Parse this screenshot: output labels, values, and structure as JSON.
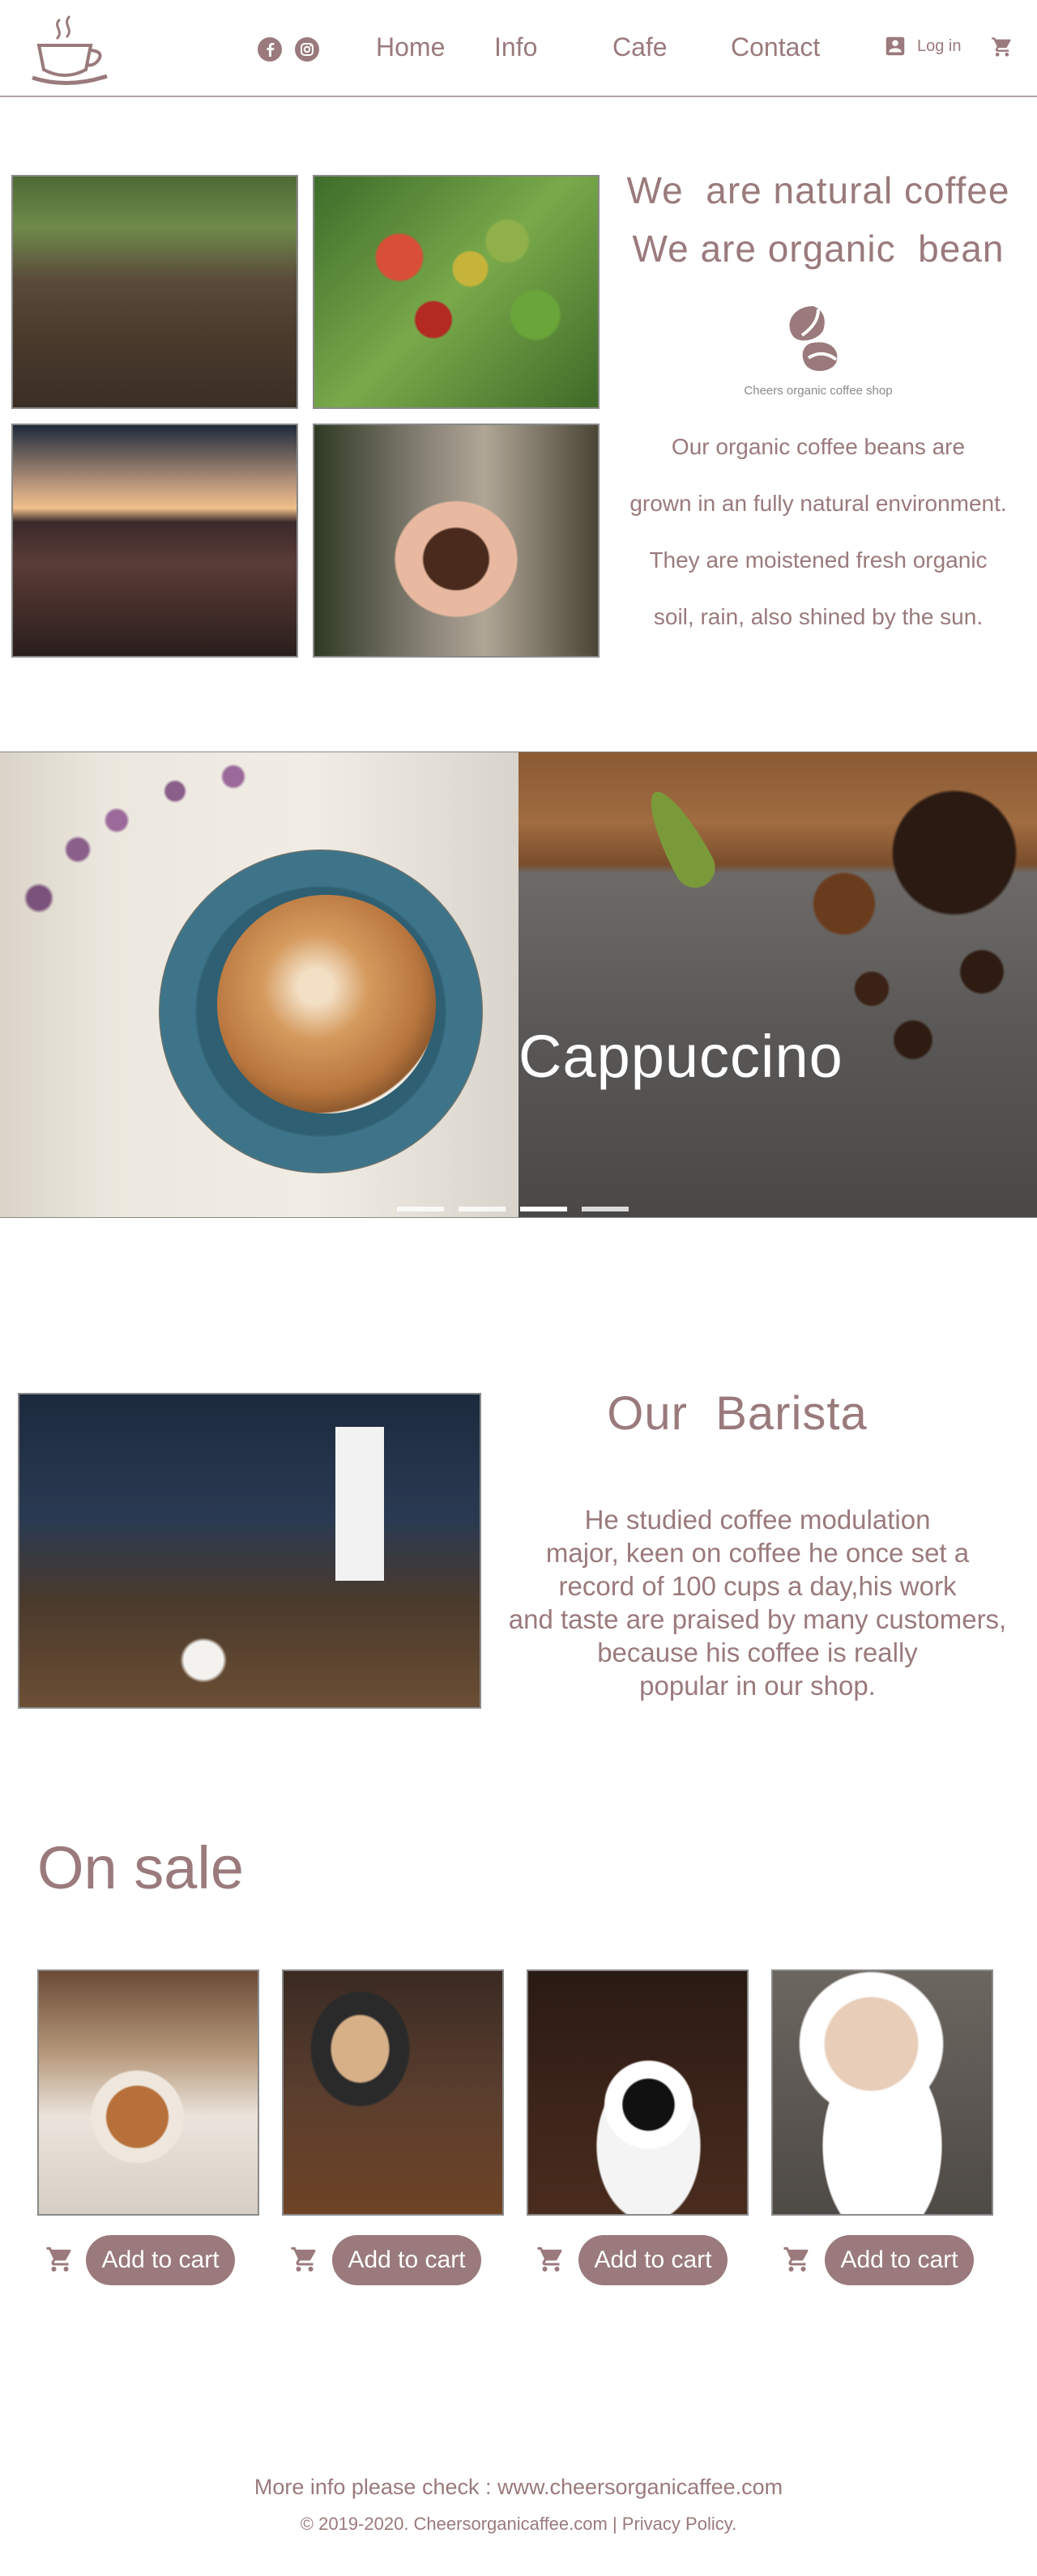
{
  "colors": {
    "accent": "#9a7a7c",
    "background": "#ffffff",
    "divider": "#b5a3a4"
  },
  "header": {
    "logo_icon": "coffee-cup-logo",
    "social": [
      "facebook-icon",
      "instagram-icon"
    ],
    "nav": [
      "Home",
      "Info",
      "Cafe",
      "Contact"
    ],
    "login_label": "Log in",
    "login_icon": "account-box-icon",
    "cart_icon": "shopping-cart-icon"
  },
  "intro": {
    "headline_1": "We  are natural coffee",
    "headline_2": "We are organic  bean",
    "shop_caption": "Cheers organic coffee shop",
    "paragraph": [
      "Our organic coffee beans are",
      "grown in  an fully natural environment.",
      "They are moistened fresh organic",
      "soil, rain, also shined by the sun."
    ]
  },
  "carousel": {
    "slide_title": "Cappuccino",
    "indicator_count": 4,
    "active_index": 2
  },
  "barista": {
    "title": "Our  Barista",
    "paragraph": [
      "He studied coffee modulation",
      "major, keen on coffee he once set a",
      "record of 100 cups a day,his work",
      "and taste are praised by many customers,",
      "because his coffee is really",
      "popular in our shop."
    ]
  },
  "sale": {
    "title": "On sale",
    "products": [
      {
        "button_label": "Add to cart"
      },
      {
        "button_label": "Add to cart"
      },
      {
        "button_label": "Add to cart"
      },
      {
        "button_label": "Add to cart"
      }
    ]
  },
  "footer": {
    "line1": "More info please check : www.cheersorganicaffee.com",
    "copyright": "© 2019-2020. Cheersorganicaffee.com",
    "separator": "|",
    "privacy": "Privacy Policy."
  }
}
